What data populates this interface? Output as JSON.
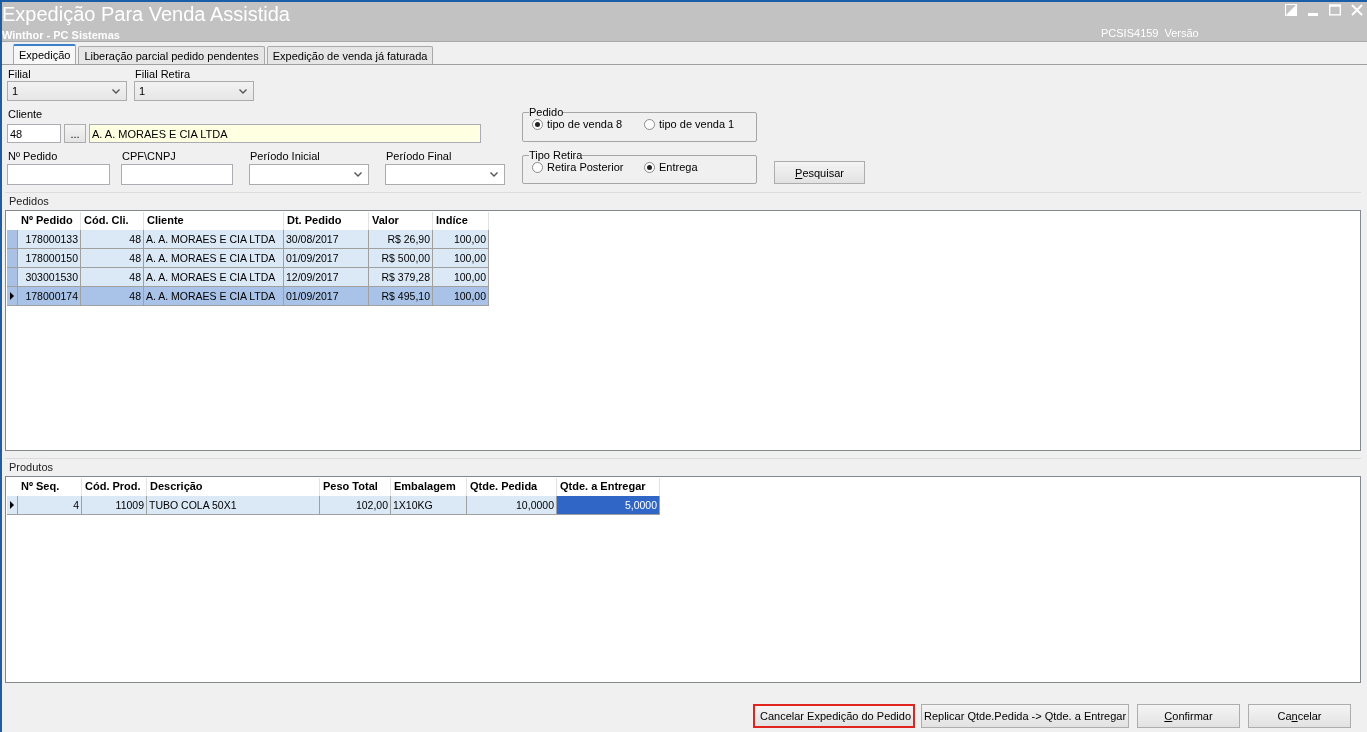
{
  "window": {
    "title": "Expedição Para Venda Assistida",
    "subtitle": "Winthor - PC Sistemas",
    "program_code": "PCSIS4159",
    "version_label": "Versão"
  },
  "tabs": [
    {
      "label": "Expedição",
      "selected": true
    },
    {
      "label": "Liberação parcial pedido pendentes",
      "selected": false
    },
    {
      "label": "Expedição de venda já faturada",
      "selected": false
    }
  ],
  "filters": {
    "filial": {
      "label": "Filial",
      "value": "1"
    },
    "filial_retira": {
      "label": "Filial Retira",
      "value": "1"
    },
    "cliente": {
      "label": "Cliente",
      "code": "48",
      "lookup_button": "...",
      "name": "A. A. MORAES E CIA LTDA"
    },
    "pedido": {
      "title": "Pedido",
      "options": [
        {
          "label": "tipo de venda 8",
          "selected": true
        },
        {
          "label": "tipo de venda 1",
          "selected": false
        }
      ]
    },
    "fields": [
      {
        "label": "Nº Pedido",
        "kind": "text"
      },
      {
        "label": "CPF\\CNPJ",
        "kind": "text"
      },
      {
        "label": "Período Inicial",
        "kind": "dropdown"
      },
      {
        "label": "Período Final",
        "kind": "dropdown"
      }
    ],
    "tipo_retira": {
      "title": "Tipo Retira",
      "options": [
        {
          "label": "Retira Posterior",
          "selected": false
        },
        {
          "label": "Entrega",
          "selected": true
        }
      ]
    },
    "search_button": {
      "label": [
        {
          "text": "P",
          "underlined": true
        },
        {
          "text": "esquisar",
          "underlined": false
        }
      ]
    }
  },
  "pedidos": {
    "title": "Pedidos",
    "columns": [
      "Nº Pedido",
      "Cód. Cli.",
      "Cliente",
      "Dt. Pedido",
      "Valor",
      "Indíce"
    ],
    "rows": [
      {
        "selected": false,
        "cells": [
          "178000133",
          "48",
          "A. A. MORAES E CIA LTDA",
          "30/08/2017",
          "R$ 26,90",
          "100,00"
        ]
      },
      {
        "selected": false,
        "cells": [
          "178000150",
          "48",
          "A. A. MORAES E CIA LTDA",
          "01/09/2017",
          "R$ 500,00",
          "100,00"
        ]
      },
      {
        "selected": false,
        "cells": [
          "303001530",
          "48",
          "A. A. MORAES E CIA LTDA",
          "12/09/2017",
          "R$ 379,28",
          "100,00"
        ]
      },
      {
        "selected": true,
        "cells": [
          "178000174",
          "48",
          "A. A. MORAES E CIA LTDA",
          "01/09/2017",
          "R$ 495,10",
          "100,00"
        ]
      }
    ]
  },
  "produtos": {
    "title": "Produtos",
    "columns": [
      "Nº Seq.",
      "Cód. Prod.",
      "Descrição",
      "Peso Total",
      "Embalagem",
      "Qtde. Pedida",
      "Qtde. a Entregar"
    ],
    "rows": [
      {
        "selected": true,
        "cells": [
          {
            "text": "4",
            "selected": false
          },
          {
            "text": "11009",
            "selected": false
          },
          {
            "text": "TUBO COLA 50X1",
            "selected": false
          },
          {
            "text": "102,00",
            "selected": false
          },
          {
            "text": "1X10KG",
            "selected": false
          },
          {
            "text": "10,0000",
            "selected": false
          },
          {
            "text": "5,0000",
            "selected": true
          }
        ]
      }
    ]
  },
  "buttons": [
    {
      "label": [
        {
          "text": "Cancelar Expedição do Pedido",
          "underlined": false
        }
      ],
      "highlighted": true
    },
    {
      "label": [
        {
          "text": "Replicar Qtde.Pedida -> Qtde. a Entregar",
          "underlined": false
        }
      ],
      "highlighted": false
    },
    {
      "label": [
        {
          "text": "C",
          "underlined": true
        },
        {
          "text": "onfirmar",
          "underlined": false
        }
      ],
      "highlighted": false
    },
    {
      "label": [
        {
          "text": "Ca",
          "underlined": false
        },
        {
          "text": "n",
          "underlined": true
        },
        {
          "text": "celar",
          "underlined": false
        }
      ],
      "highlighted": false
    }
  ]
}
